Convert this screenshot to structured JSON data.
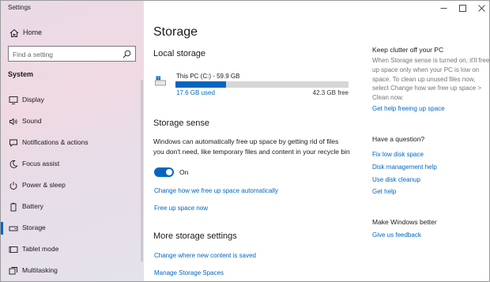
{
  "window": {
    "title": "Settings"
  },
  "sidebar": {
    "home_label": "Home",
    "search_placeholder": "Find a setting",
    "section": "System",
    "items": [
      {
        "label": "Display",
        "icon": "monitor-icon"
      },
      {
        "label": "Sound",
        "icon": "speaker-icon"
      },
      {
        "label": "Notifications & actions",
        "icon": "message-icon"
      },
      {
        "label": "Focus assist",
        "icon": "moon-icon"
      },
      {
        "label": "Power & sleep",
        "icon": "power-icon"
      },
      {
        "label": "Battery",
        "icon": "battery-icon"
      },
      {
        "label": "Storage",
        "icon": "storage-icon",
        "selected": true
      },
      {
        "label": "Tablet mode",
        "icon": "tablet-icon"
      },
      {
        "label": "Multitasking",
        "icon": "multitasking-icon"
      }
    ]
  },
  "main": {
    "title": "Storage",
    "local_storage": {
      "heading": "Local storage",
      "drive": {
        "name": "This PC (C:) - 59.9 GB",
        "used": "17.6 GB used",
        "free": "42.3 GB free",
        "used_fraction": 0.294
      }
    },
    "storage_sense": {
      "heading": "Storage sense",
      "description": "Windows can automatically free up space by getting rid of files you don't need, like temporary files and content in your recycle bin",
      "toggle_state": "On",
      "links": [
        "Change how we free up space automatically",
        "Free up space now"
      ]
    },
    "more": {
      "heading": "More storage settings",
      "links": [
        "Change where new content is saved",
        "Manage Storage Spaces"
      ]
    }
  },
  "right": {
    "clutter": {
      "heading": "Keep clutter off your PC",
      "text": "When Storage sense is turned on, it'll free up space only when your PC is low on space. To clean up unused files now, select Change how we free up space > Clean now.",
      "link": "Get help freeing up space"
    },
    "question": {
      "heading": "Have a question?",
      "links": [
        "Fix low disk space",
        "Disk management help",
        "Use disk cleanup",
        "Get help"
      ]
    },
    "better": {
      "heading": "Make Windows better",
      "link": "Give us feedback"
    }
  },
  "colors": {
    "accent": "#0067c0",
    "track": "#d6d6d6"
  }
}
